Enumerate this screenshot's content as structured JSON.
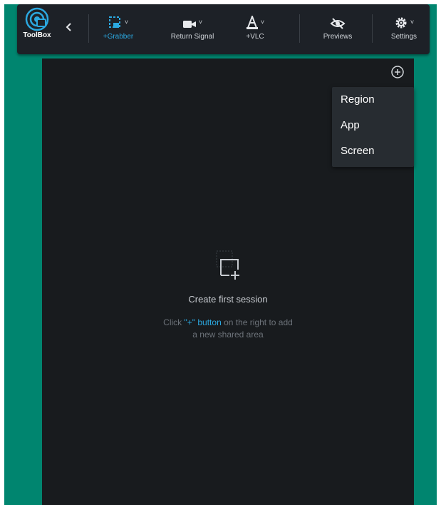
{
  "toolbar": {
    "logo_label": "ToolBox",
    "items": [
      {
        "label": "Grabber",
        "prefix": "+",
        "icon": "region-select-icon",
        "active": true
      },
      {
        "label": "Return Signal",
        "prefix": "",
        "icon": "camera-icon",
        "active": false
      },
      {
        "label": "VLC",
        "prefix": "+",
        "icon": "vlc-cone-icon",
        "active": false
      },
      {
        "label": "Previews",
        "prefix": "",
        "icon": "eye-off-icon",
        "active": false
      },
      {
        "label": "Settings",
        "prefix": "",
        "icon": "gear-icon",
        "active": false
      }
    ],
    "caret": "˅"
  },
  "menu": {
    "items": [
      "Region",
      "App",
      "Screen"
    ]
  },
  "empty_state": {
    "title": "Create first session",
    "sub_before": "Click ",
    "sub_highlight": "\"+\" button",
    "sub_after": " on the right to add",
    "sub_line2": "a new shared area"
  },
  "colors": {
    "frame": "#00856f",
    "toolbar": "#1d2127",
    "panel": "#181b1e",
    "accent": "#2ba8e0"
  }
}
